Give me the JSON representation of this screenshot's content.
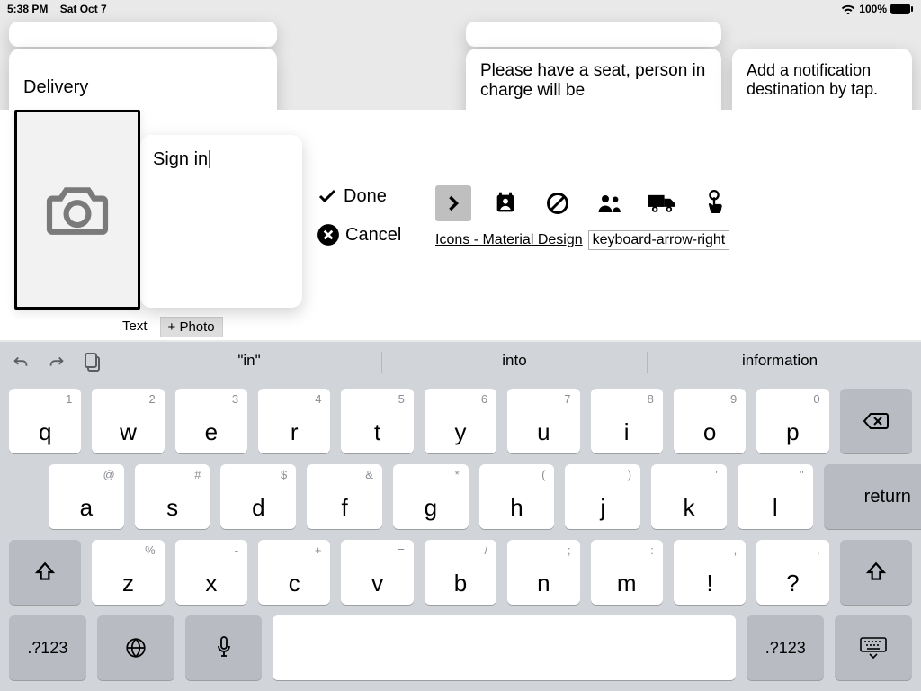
{
  "status": {
    "time": "5:38 PM",
    "date": "Sat Oct 7",
    "battery": "100%"
  },
  "cards": {
    "delivery": "Delivery",
    "seat": "Please have a seat, person in charge will be",
    "notify": "Add a notification destination by tap."
  },
  "editor": {
    "text_value": "Sign in",
    "done": "Done",
    "cancel": "Cancel",
    "icons_link": "Icons - Material Design",
    "icon_name": "keyboard-arrow-right",
    "tabs": {
      "text": "Text",
      "photo": "+ Photo"
    }
  },
  "keyboard": {
    "suggestions": [
      "\"in\"",
      "into",
      "information"
    ],
    "row1": [
      {
        "main": "q",
        "hint": "1"
      },
      {
        "main": "w",
        "hint": "2"
      },
      {
        "main": "e",
        "hint": "3"
      },
      {
        "main": "r",
        "hint": "4"
      },
      {
        "main": "t",
        "hint": "5"
      },
      {
        "main": "y",
        "hint": "6"
      },
      {
        "main": "u",
        "hint": "7"
      },
      {
        "main": "i",
        "hint": "8"
      },
      {
        "main": "o",
        "hint": "9"
      },
      {
        "main": "p",
        "hint": "0"
      }
    ],
    "row2": [
      {
        "main": "a",
        "hint": "@"
      },
      {
        "main": "s",
        "hint": "#"
      },
      {
        "main": "d",
        "hint": "$"
      },
      {
        "main": "f",
        "hint": "&"
      },
      {
        "main": "g",
        "hint": "*"
      },
      {
        "main": "h",
        "hint": "("
      },
      {
        "main": "j",
        "hint": ")"
      },
      {
        "main": "k",
        "hint": "'"
      },
      {
        "main": "l",
        "hint": "\""
      }
    ],
    "row3": [
      {
        "main": "z",
        "hint": "%"
      },
      {
        "main": "x",
        "hint": "-"
      },
      {
        "main": "c",
        "hint": "+"
      },
      {
        "main": "v",
        "hint": "="
      },
      {
        "main": "b",
        "hint": "/"
      },
      {
        "main": "n",
        "hint": ";"
      },
      {
        "main": "m",
        "hint": ":"
      },
      {
        "main": "!",
        "hint": ","
      },
      {
        "main": "?",
        "hint": "."
      }
    ],
    "return": "return",
    "numkey": ".?123"
  }
}
